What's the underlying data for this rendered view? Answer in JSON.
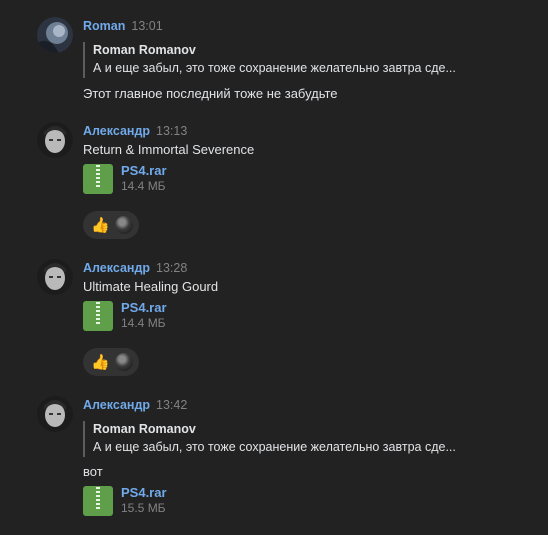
{
  "messages": [
    {
      "author": "Roman",
      "time": "13:01",
      "avatar": "roman-avatar",
      "reply": {
        "author": "Roman Romanov",
        "text": "А и еще забыл, это тоже сохранение желательно завтра сде..."
      },
      "text": "Этот главное последний тоже не забудьте"
    },
    {
      "author": "Александр",
      "time": "13:13",
      "avatar": "aleksandr-avatar",
      "text": "Return & Immortal Severence",
      "file": {
        "name": "PS4.rar",
        "size": "14.4 МБ",
        "icon": "archive-icon"
      },
      "reaction": {
        "emoji": "👍",
        "icon": "thumbs-up-icon"
      }
    },
    {
      "author": "Александр",
      "time": "13:28",
      "avatar": "aleksandr-avatar",
      "text": "Ultimate Healing Gourd",
      "file": {
        "name": "PS4.rar",
        "size": "14.4 МБ",
        "icon": "archive-icon"
      },
      "reaction": {
        "emoji": "👍",
        "icon": "thumbs-up-icon"
      }
    },
    {
      "author": "Александр",
      "time": "13:42",
      "avatar": "aleksandr-avatar",
      "reply": {
        "author": "Roman Romanov",
        "text": "А и еще забыл, это тоже сохранение желательно завтра сде..."
      },
      "text": "вот",
      "file": {
        "name": "PS4.rar",
        "size": "15.5 МБ",
        "icon": "archive-icon"
      }
    }
  ],
  "colors": {
    "background": "#222222",
    "link": "#71aaeb",
    "text": "#e1e3e6",
    "muted": "#828282",
    "file_icon": "#5f9f4a",
    "reaction_bg": "#333333"
  }
}
